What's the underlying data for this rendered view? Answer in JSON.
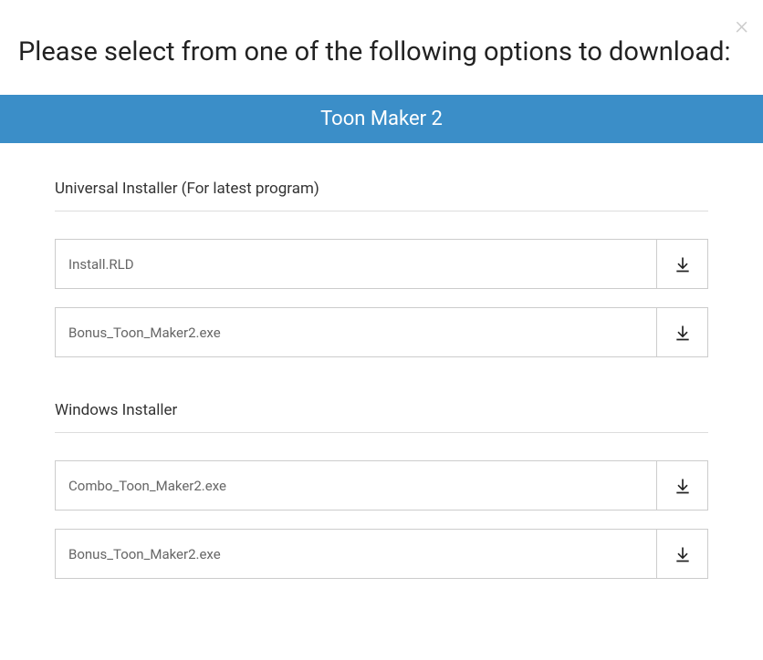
{
  "heading": "Please select from one of the following options to download:",
  "product_title": "Toon Maker 2",
  "sections": [
    {
      "title": "Universal Installer (For latest program)",
      "files": [
        {
          "name": "Install.RLD"
        },
        {
          "name": "Bonus_Toon_Maker2.exe"
        }
      ]
    },
    {
      "title": "Windows Installer",
      "files": [
        {
          "name": "Combo_Toon_Maker2.exe"
        },
        {
          "name": "Bonus_Toon_Maker2.exe"
        }
      ]
    }
  ]
}
